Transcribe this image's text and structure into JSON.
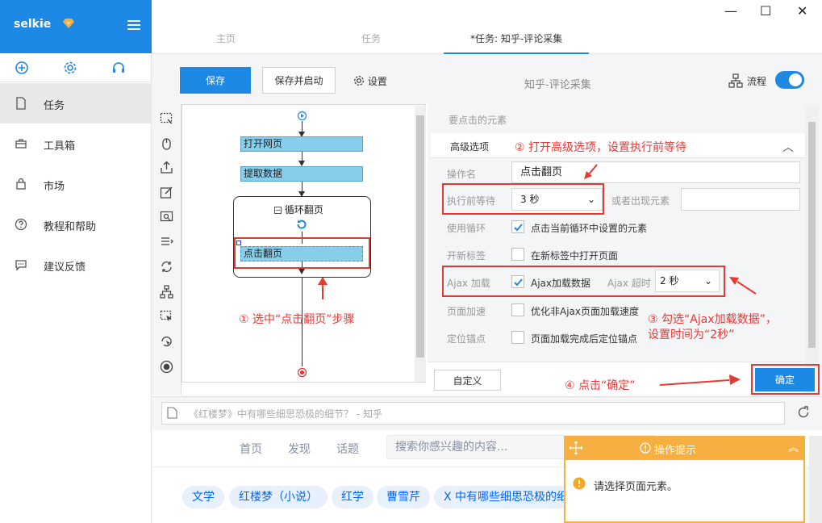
{
  "app": {
    "name": "selkie"
  },
  "sidebar": {
    "items": [
      {
        "label": "任务"
      },
      {
        "label": "工具箱"
      },
      {
        "label": "市场"
      },
      {
        "label": "教程和帮助"
      },
      {
        "label": "建议反馈"
      }
    ]
  },
  "tabs": [
    {
      "label": "主页"
    },
    {
      "label": "任务"
    },
    {
      "label": "*任务: 知乎-评论采集"
    }
  ],
  "toolbar": {
    "save_label": "保存",
    "save_start_label": "保存并启动",
    "settings_label": "设置",
    "task_title": "知乎-评论采集",
    "flow_label": "流程"
  },
  "flow": {
    "steps": [
      {
        "label": "打开网页"
      },
      {
        "label": "提取数据"
      }
    ],
    "loop_label": "循环翻页",
    "loop_step": "点击翻页"
  },
  "annotations": {
    "a1": "① 选中“点击翻页”步骤",
    "a2": "② 打开高级选项，设置执行前等待",
    "a3_line1": "③ 勾选“Ajax加载数据”，",
    "a3_line2": "设置时间为“2秒”",
    "a4": "④ 点击“确定”"
  },
  "props": {
    "section_title": "要点击的元素",
    "advanced_label": "高级选项",
    "op_name_label": "操作名",
    "op_name_value": "点击翻页",
    "wait_label": "执行前等待",
    "wait_value": "3 秒",
    "or_appear_label": "或者出现元素",
    "use_loop_label": "使用循环",
    "use_loop_text": "点击当前循环中设置的元素",
    "new_tab_label": "开新标签",
    "new_tab_text": "在新标签中打开页面",
    "ajax_label": "Ajax 加载",
    "ajax_text": "Ajax加载数据",
    "ajax_timeout_label": "Ajax 超时",
    "ajax_timeout_value": "2 秒",
    "speed_label": "页面加速",
    "speed_text": "优化非Ajax页面加载速度",
    "anchor_label": "定位锚点",
    "anchor_text": "页面加载完成后定位锚点",
    "custom_label": "自定义",
    "ok_label": "确定"
  },
  "browser": {
    "url_title": "《红楼梦》中有哪些细思恐极的细节？ - 知乎",
    "nav": [
      "首页",
      "发现",
      "话题"
    ],
    "search_placeholder": "搜索你感兴趣的内容...",
    "topics": [
      "文学",
      "红楼梦（小说）",
      "红学",
      "曹雪芹",
      "X 中有哪些细思恐极的细"
    ]
  },
  "hint": {
    "title": "操作提示",
    "message": "请选择页面元素。"
  },
  "colors": {
    "accent": "#1e88e5",
    "annotation": "#e53935",
    "hint": "#f5b041",
    "step": "#87ceeb"
  }
}
